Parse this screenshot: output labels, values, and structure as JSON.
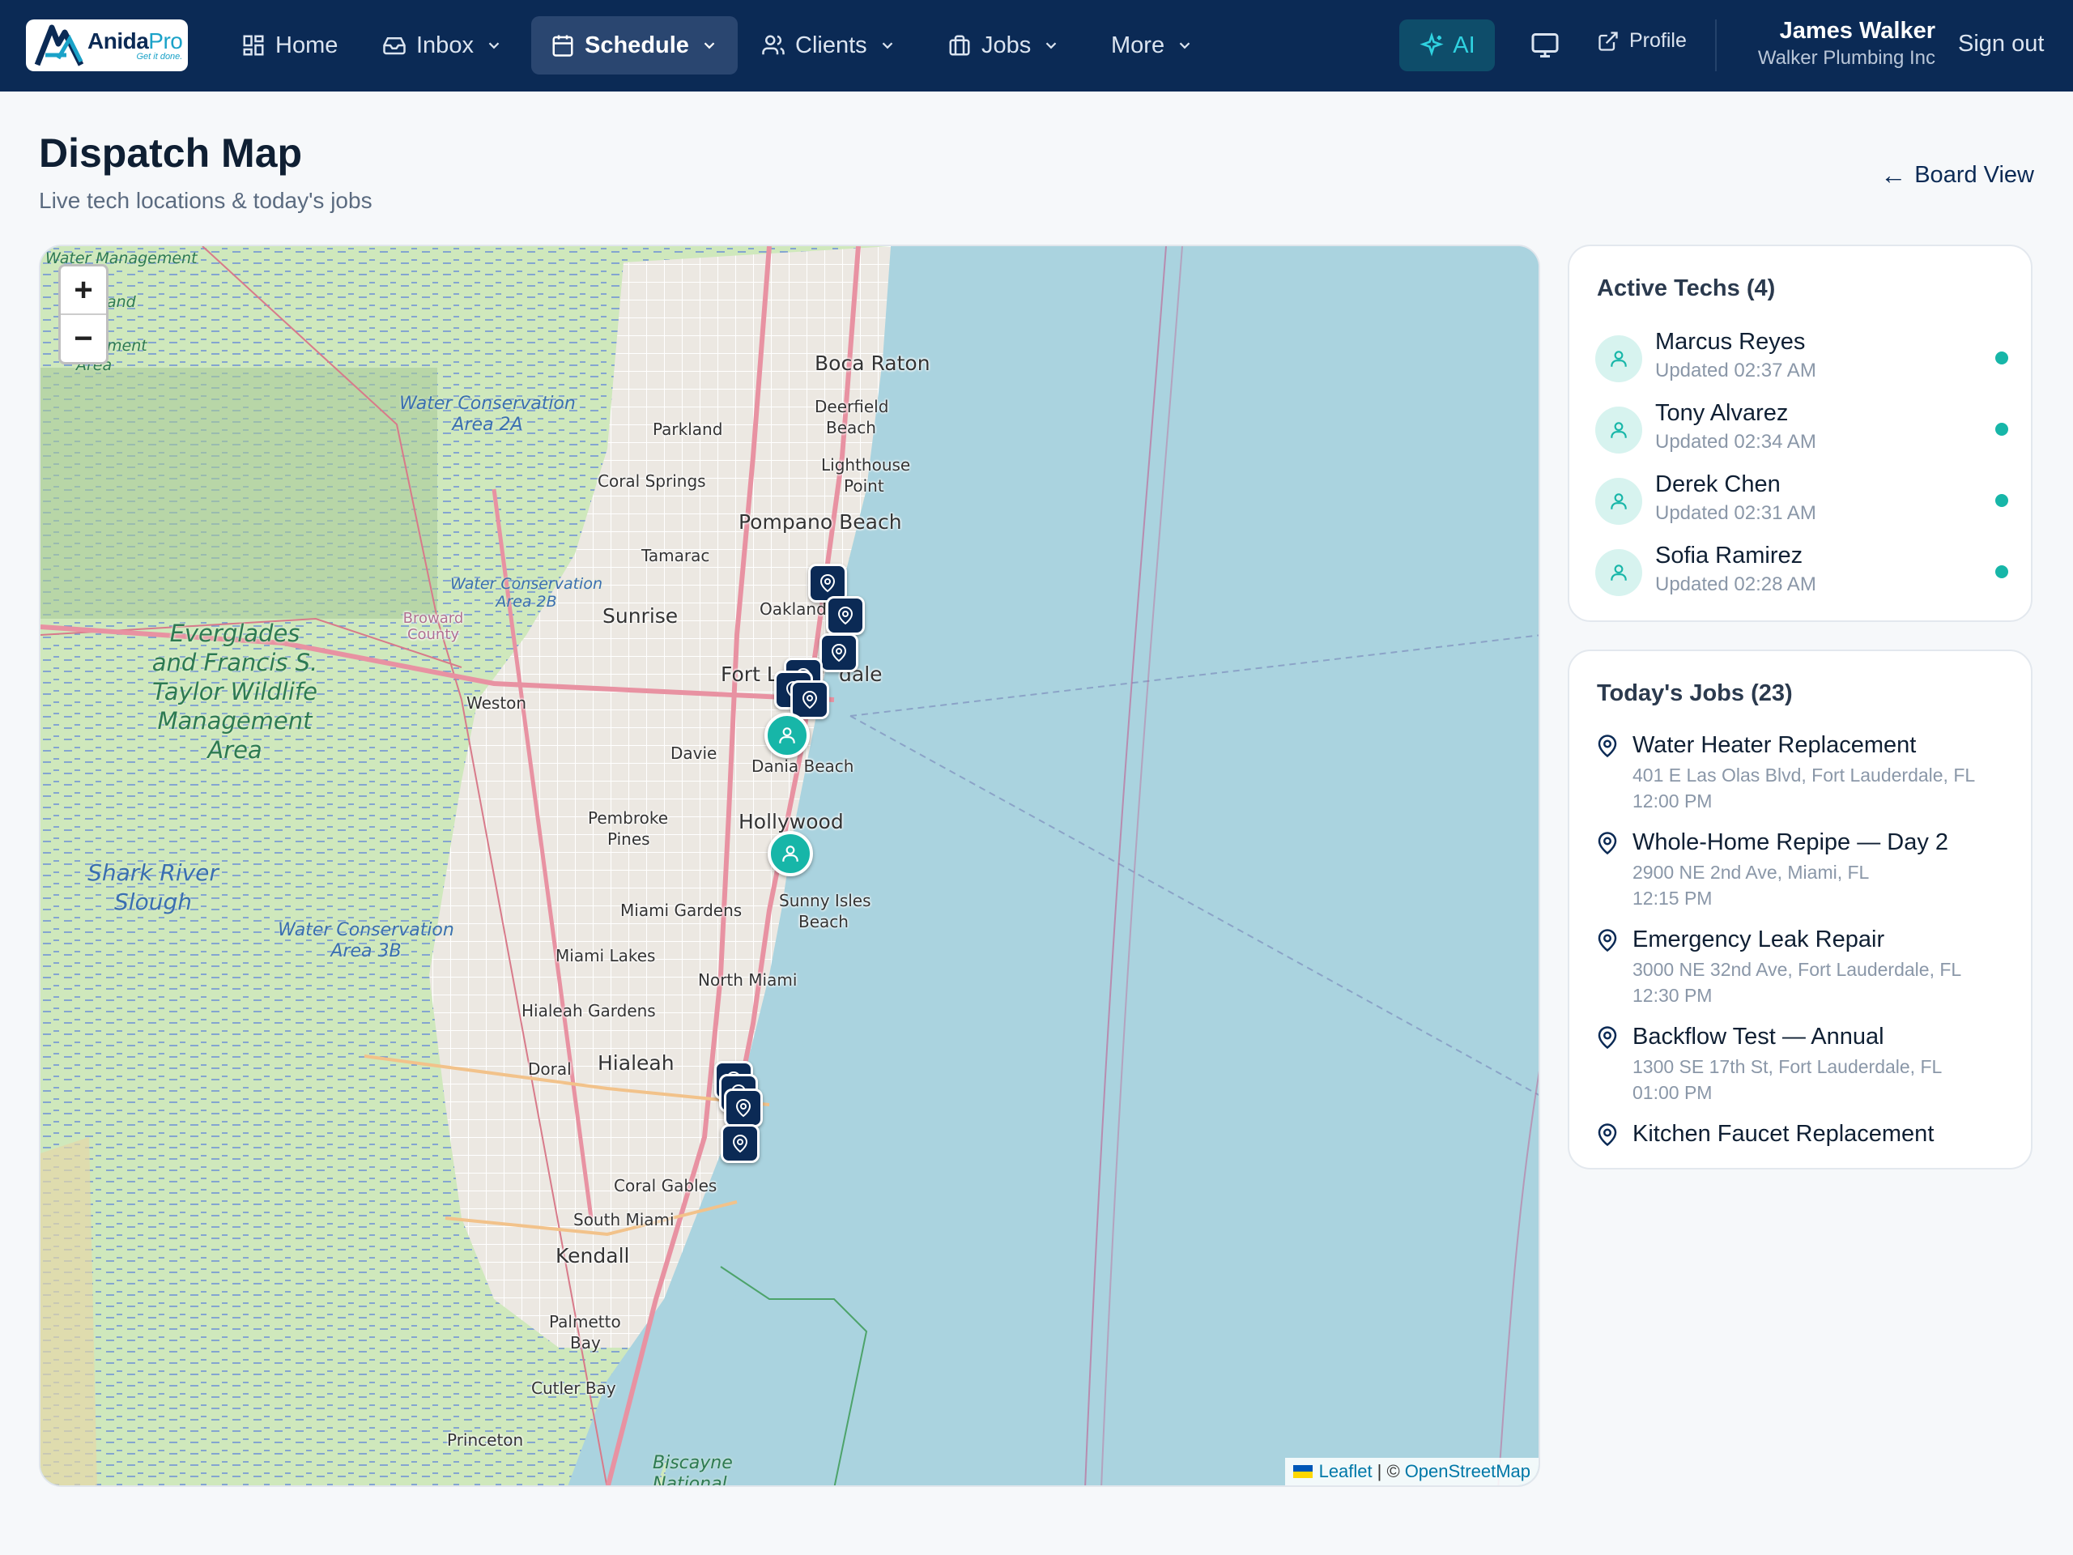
{
  "nav": {
    "logo": {
      "name": "Anida",
      "name_accent": "Pro",
      "tagline": "Get it done."
    },
    "items": [
      {
        "label": "Home",
        "icon": "grid-icon"
      },
      {
        "label": "Inbox",
        "icon": "inbox-icon"
      },
      {
        "label": "Schedule",
        "icon": "calendar-icon"
      },
      {
        "label": "Clients",
        "icon": "users-icon"
      },
      {
        "label": "Jobs",
        "icon": "briefcase-icon"
      },
      {
        "label": "More"
      }
    ],
    "active": "Schedule",
    "ai_label": "AI",
    "profile_label": "Profile",
    "user_name": "James Walker",
    "company": "Walker Plumbing Inc",
    "signout_label": "Sign out"
  },
  "header": {
    "title": "Dispatch Map",
    "subtitle": "Live tech locations & today's jobs",
    "board_view_label": "Board View"
  },
  "map": {
    "zoom_in": "+",
    "zoom_out": "−",
    "attribution_leaflet": "Leaflet",
    "attribution_sep": "| ©",
    "attribution_osm": "OpenStreetMap",
    "labels": {
      "boca_raton": "Boca Raton",
      "deerfield": "Deerfield",
      "beach": "Beach",
      "parkland": "Parkland",
      "coral_springs": "Coral Springs",
      "lighthouse": "Lighthouse",
      "point": "Point",
      "pompano": "Pompano Beach",
      "tamarac": "Tamarac",
      "sunrise": "Sunrise",
      "oakland": "Oakland",
      "fort": "Fort L",
      "dale": "dale",
      "weston": "Weston",
      "davie": "Davie",
      "dania": "Dania Beach",
      "pembroke": "Pembroke",
      "pines": "Pines",
      "hollywood": "Hollywood",
      "sunny_isles": "Sunny Isles",
      "sunny_beach": "Beach",
      "miami_gardens": "Miami Gardens",
      "miami_lakes": "Miami Lakes",
      "north_miami": "North Miami",
      "hialeah_gardens": "Hialeah Gardens",
      "doral": "Doral",
      "hialeah": "Hialeah",
      "coral_gables": "Coral Gables",
      "south_miami": "South Miami",
      "kendall": "Kendall",
      "palmetto": "Palmetto",
      "bay": "Bay",
      "cutler_bay": "Cutler Bay",
      "princeton": "Princeton",
      "biscayne": "Biscayne",
      "national": "National",
      "everglades": "Everglades and Francis S. Taylor Wildlife Management Area",
      "wca2a": "Water Conservation Area 2A",
      "wca2b": "Water Conservation Area 2B",
      "wca3b": "Water Conservation Area 3B",
      "shark_river": "Shark River Slough",
      "broward": "Broward County",
      "water_mgmt": "Water Management",
      "wm_and": "and",
      "wm_ment": "ment",
      "wm_area": "Area"
    }
  },
  "techs": {
    "title": "Active Techs (4)",
    "items": [
      {
        "name": "Marcus Reyes",
        "updated": "Updated 02:37 AM"
      },
      {
        "name": "Tony Alvarez",
        "updated": "Updated 02:34 AM"
      },
      {
        "name": "Derek Chen",
        "updated": "Updated 02:31 AM"
      },
      {
        "name": "Sofia Ramirez",
        "updated": "Updated 02:28 AM"
      }
    ]
  },
  "jobs": {
    "title": "Today's Jobs (23)",
    "items": [
      {
        "title": "Water Heater Replacement",
        "address": "401 E Las Olas Blvd, Fort Lauderdale, FL",
        "time": "12:00 PM"
      },
      {
        "title": "Whole-Home Repipe — Day 2",
        "address": "2900 NE 2nd Ave, Miami, FL",
        "time": "12:15 PM"
      },
      {
        "title": "Emergency Leak Repair",
        "address": "3000 NE 32nd Ave, Fort Lauderdale, FL",
        "time": "12:30 PM"
      },
      {
        "title": "Backflow Test — Annual",
        "address": "1300 SE 17th St, Fort Lauderdale, FL",
        "time": "01:00 PM"
      },
      {
        "title": "Kitchen Faucet Replacement",
        "address": "",
        "time": ""
      }
    ]
  },
  "colors": {
    "nav_bg": "#0b2a55",
    "accent_teal": "#17b6a8",
    "job_pin": "#0b2a55"
  }
}
